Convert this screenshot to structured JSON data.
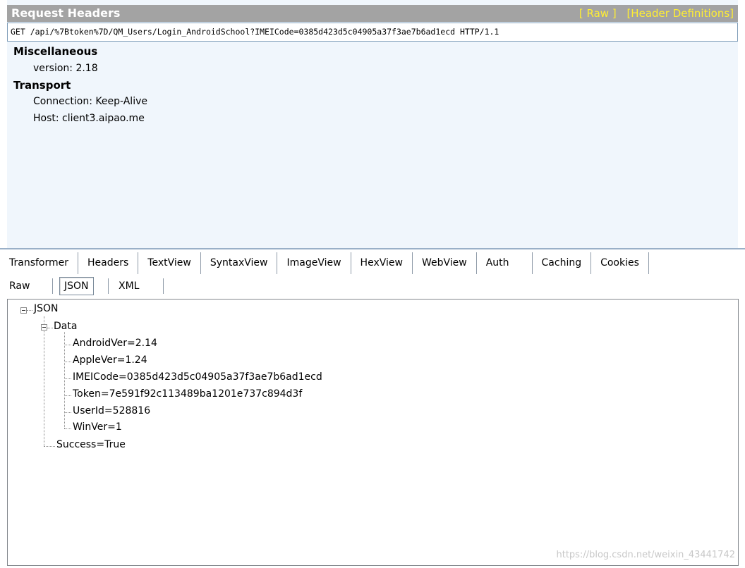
{
  "request": {
    "title": "Request Headers",
    "links": [
      "[ Raw ]",
      "[Header Definitions]"
    ],
    "request_line": "GET /api/%7Btoken%7D/QM_Users/Login_AndroidSchool?IMEICode=0385d423d5c04905a37f3ae7b6ad1ecd HTTP/1.1",
    "groups": [
      {
        "title": "Miscellaneous",
        "headers": [
          "version: 2.18"
        ]
      },
      {
        "title": "Transport",
        "headers": [
          "Connection: Keep-Alive",
          "Host: client3.aipao.me"
        ]
      }
    ]
  },
  "tabs": [
    "Transformer",
    "Headers",
    "TextView",
    "SyntaxView",
    "ImageView",
    "HexView",
    "WebView",
    "Auth",
    "Caching",
    "Cookies"
  ],
  "subtabs": {
    "raw": "Raw",
    "json": "JSON",
    "xml": "XML",
    "selected": "JSON"
  },
  "tree": {
    "root": "JSON",
    "data_node": "Data",
    "data_children": [
      "AndroidVer=2.14",
      "AppleVer=1.24",
      "IMEICode=0385d423d5c04905a37f3ae7b6ad1ecd",
      "Token=7e591f92c113489ba1201e737c894d3f",
      "UserId=528816",
      "WinVer=1"
    ],
    "success": "Success=True"
  },
  "watermark": "https://blog.csdn.net/weixin_43441742"
}
